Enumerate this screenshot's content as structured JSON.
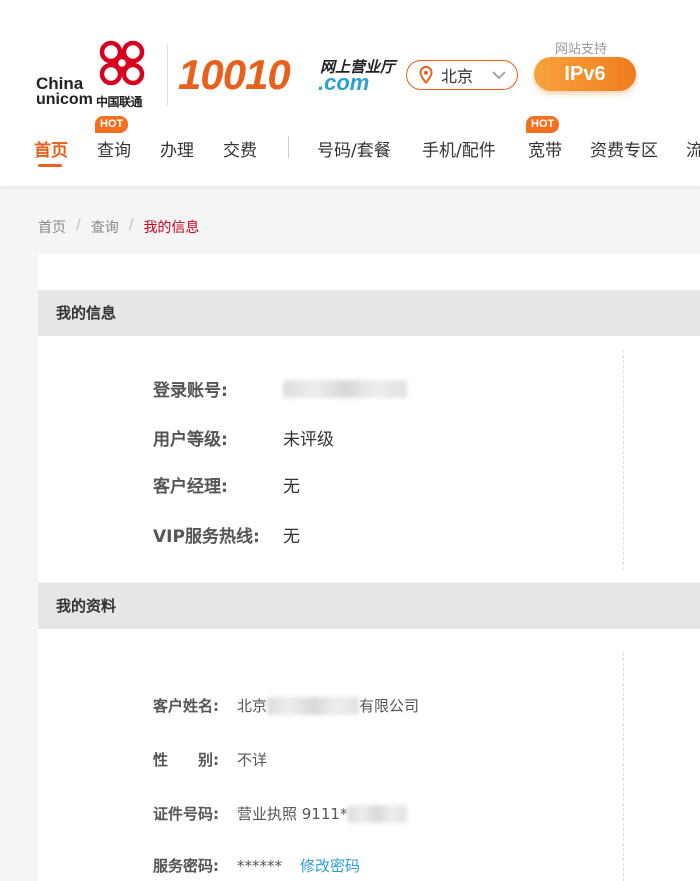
{
  "brand": {
    "china": "China",
    "unicom": "unicom",
    "chinese_name": "中国联通",
    "number": "10010",
    "site_cn": "网上营业厅",
    "site_domain": ".com",
    "accent": "#e8601c"
  },
  "location": {
    "city": "北京",
    "icon": "map-pin-icon"
  },
  "ipv6": {
    "caption": "网站支持",
    "label": "IPv6"
  },
  "nav": {
    "items": [
      {
        "label": "首页",
        "active": true
      },
      {
        "label": "查询",
        "hot": "HOT"
      },
      {
        "label": "办理"
      },
      {
        "label": "交费"
      },
      {
        "label": "号码/套餐"
      },
      {
        "label": "手机/配件"
      },
      {
        "label": "宽带",
        "hot": "HOT"
      },
      {
        "label": "资费专区"
      },
      {
        "label": "流"
      }
    ]
  },
  "breadcrumb": {
    "home": "首页",
    "query": "查询",
    "current": "我的信息",
    "separator": "/"
  },
  "my_info": {
    "title": "我的信息",
    "login_label": "登录账号:",
    "level_label": "用户等级:",
    "level_value": "未评级",
    "manager_label": "客户经理:",
    "manager_value": "无",
    "vip_label": "VIP服务热线:",
    "vip_value": "无"
  },
  "my_profile": {
    "title": "我的资料",
    "name_label": "客户姓名:",
    "name_prefix": "北京",
    "name_suffix": "有限公司",
    "gender_label": "性　　别:",
    "gender_value": "不详",
    "id_label": "证件号码:",
    "id_value": "营业执照 9111*",
    "password_label": "服务密码:",
    "password_value": "******",
    "change_password": "修改密码"
  }
}
